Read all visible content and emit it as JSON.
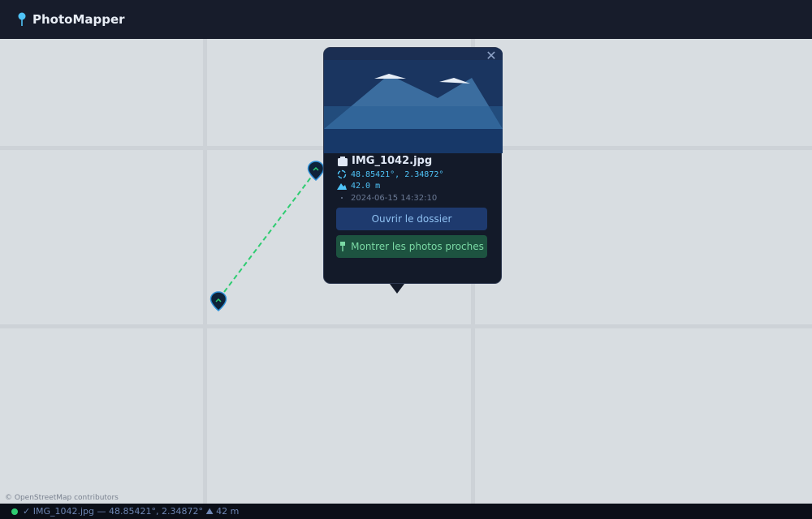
{
  "app": {
    "title": "PhotoMapper",
    "logo_icon": "map-pin-icon",
    "accent_color": "#4fc3f7"
  },
  "map": {
    "attribution": "© OpenStreetMap contributors",
    "track_color": "#2ecc71"
  },
  "popup": {
    "close_label": "✕",
    "filename": "IMG_1042.jpg",
    "coordinates": "48.85421°, 2.34872°",
    "altitude": "42.0 m",
    "timestamp": "2024-06-15 14:32:10",
    "open_folder_label": "Ouvrir le dossier",
    "nearby_label": "Montrer les photos proches"
  },
  "status": {
    "text": "✓ IMG_1042.jpg — 48.85421°, 2.34872° ⛰ 42 m",
    "indicator_color": "#2ecc71"
  }
}
